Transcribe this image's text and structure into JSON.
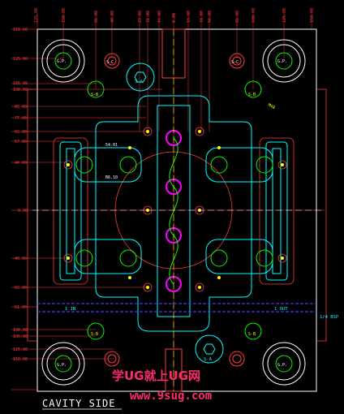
{
  "title": "CAVITY SIDE",
  "watermark": {
    "line1": "学UG就上UG网",
    "line2": "www.9sug.com"
  },
  "top_dims": [
    "125.00",
    "150.00",
    "65.00",
    "40.00",
    "27.00",
    "31.00",
    "16.00",
    "0.00",
    "15.00",
    "31.00",
    "56.00",
    "65.00",
    "100.00",
    "125.00",
    "150.00"
  ],
  "left_dims": [
    "150.00",
    "125.00",
    "105.00",
    "100.00",
    "85.00",
    "77.00",
    "65.00",
    "57.00",
    "40.00",
    "0.00",
    "40.00",
    "65.00",
    "81.00",
    "100.00",
    "105.00",
    "125.00",
    "150.00"
  ],
  "labels": {
    "gp": "G.P.",
    "sa": "S-A",
    "sb": "S-B",
    "sb_alt": "S-C",
    "in_label": "1 IN",
    "out_label": "1 OUT",
    "note_top": "M48",
    "note_right": "1/4 BSP",
    "ann_a": "54.01",
    "ann_b": "B6.10"
  },
  "colors": {
    "background": "#000000",
    "frame": "#ffffff",
    "dimension": "#ff3b3b",
    "cavity": "#00ffff",
    "insert": "#ff00ff",
    "cooling": "#00ff00",
    "cooling_line": "#0000ff",
    "center_line": "#ffff00"
  }
}
